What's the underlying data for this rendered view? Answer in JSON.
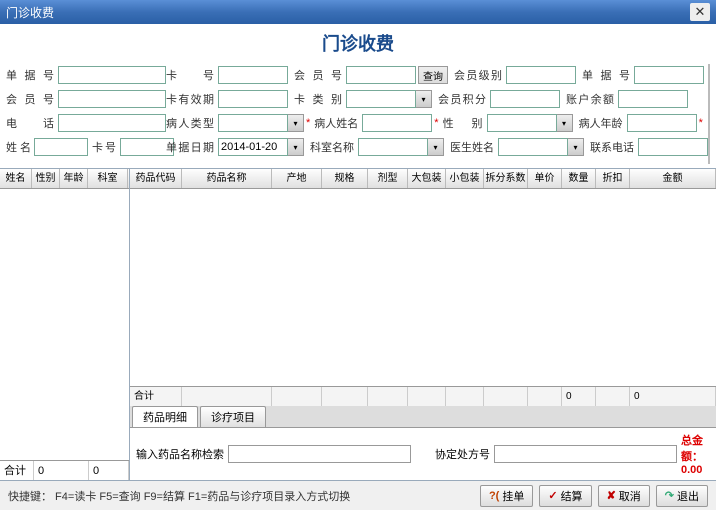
{
  "window": {
    "title": "门诊收费"
  },
  "header": {
    "title": "门诊收费"
  },
  "formLeft": {
    "danjuhao": "单据号",
    "huiyuanhao": "会员号",
    "dianhua": "电 话",
    "xingming": "姓 名",
    "kahao": "卡号"
  },
  "form": {
    "r1": {
      "l1": "卡  号",
      "l2": "会 员 号",
      "btn": "查询",
      "l3": "会员级别",
      "l4": "单 据 号"
    },
    "r2": {
      "l1": "卡有效期",
      "l2": "卡 类 别",
      "l3": "会员积分",
      "l4": "账户余额"
    },
    "r3": {
      "l1": "病人类型",
      "l2": "病人姓名",
      "l3": "性  别",
      "l4": "病人年龄"
    },
    "r4": {
      "l1": "单据日期",
      "v1": "2014-01-20",
      "l2": "科室名称",
      "l3": "医生姓名",
      "l4": "联系电话"
    }
  },
  "sideGrid": {
    "h1": "姓名",
    "h2": "性别",
    "h3": "年龄",
    "h4": "科室"
  },
  "sideSum": {
    "label": "合计",
    "v1": "0",
    "v2": "0"
  },
  "mainGrid": {
    "h1": "药品代码",
    "h2": "药品名称",
    "h3": "产地",
    "h4": "规格",
    "h5": "剂型",
    "h6": "大包装",
    "h7": "小包装",
    "h8": "拆分系数",
    "h9": "单价",
    "h10": "数量",
    "h11": "折扣",
    "h12": "金额"
  },
  "mainSum": {
    "label": "合计",
    "v1": "0",
    "v2": "0"
  },
  "tabs": {
    "t1": "药品明细",
    "t2": "诊疗项目"
  },
  "search": {
    "label": "输入药品名称检索",
    "rx": "协定处方号",
    "totalLabel": "总金额：",
    "totalVal": "0.00"
  },
  "footer": {
    "shortcuts": "快捷键： F4=读卡  F5=查询  F9=结算  F1=药品与诊疗项目录入方式切换",
    "b1": "挂单",
    "b2": "结算",
    "b3": "取消",
    "b4": "退出"
  }
}
